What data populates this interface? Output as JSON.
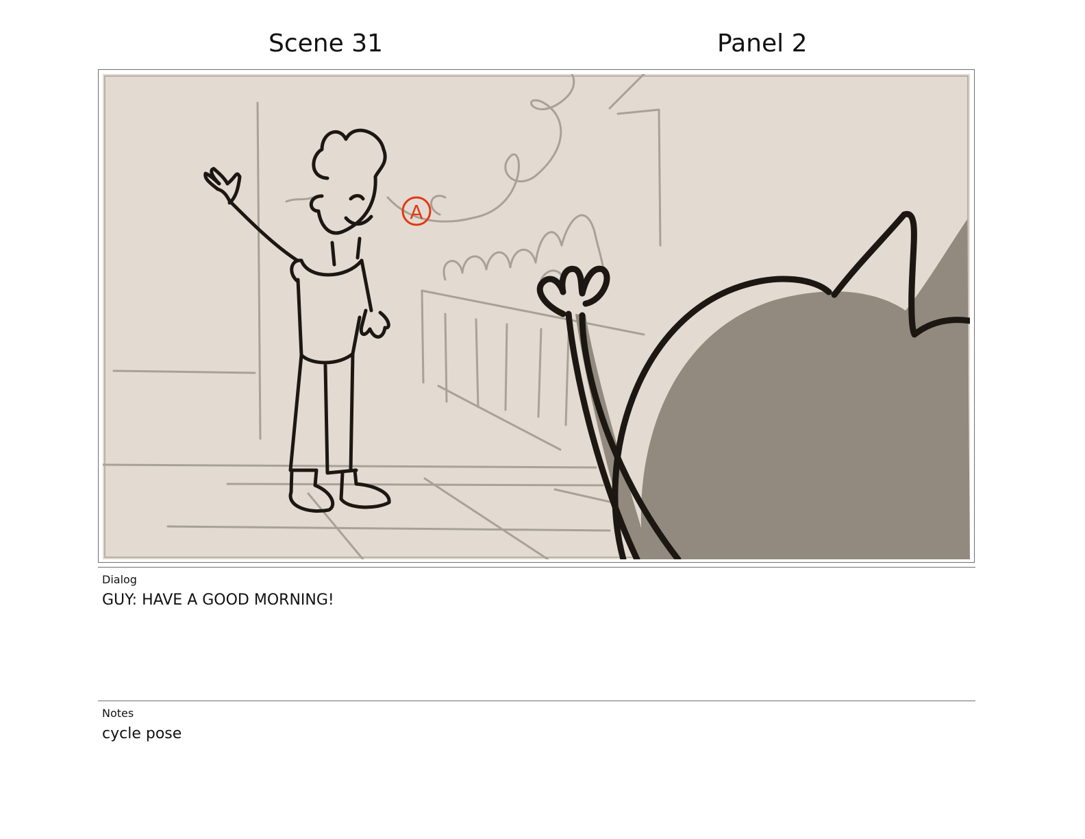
{
  "header": {
    "scene": "Scene 31",
    "panel": "Panel 2"
  },
  "drawing": {
    "annotation": "A",
    "colors": {
      "paper": "#e3dbd1",
      "sketch": "#a7a198",
      "ink": "#1c1712",
      "shadow": "#928a7e",
      "markup": "#e03a14"
    }
  },
  "dialog": {
    "label": "Dialog",
    "text": "GUY: HAVE A  GOOD MORNING!"
  },
  "notes": {
    "label": "Notes",
    "text": "cycle pose"
  }
}
